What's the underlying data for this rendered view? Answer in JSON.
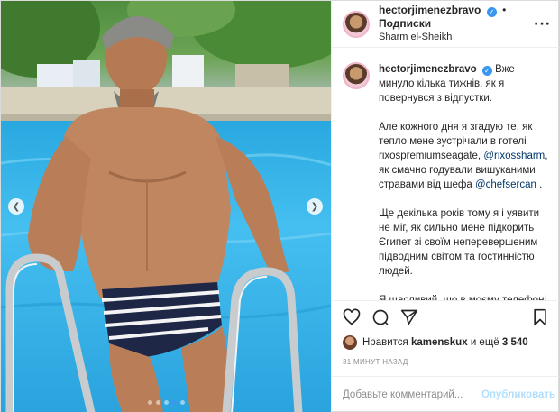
{
  "header": {
    "username": "hectorjimenezbravo",
    "separator": "•",
    "follow_label": "Подписки",
    "location": "Sharm el-Sheikh",
    "more_icon": "more-horizontal-icon"
  },
  "caption": {
    "username": "hectorjimenezbravo",
    "intro": "Вже минуло кілька тижнів, як я повернувся з відпустки.",
    "p2_a": "Але кожного дня я згадую те, як тепло мене зустрічали в готелі rixospremiumseagate,",
    "p2_mention1": "@rixossharm",
    "p2_b": ", як смачно годували вишуканими стравами від шефа",
    "p2_mention2": "@chefsercan",
    "p2_c": ".",
    "p3": "Ще декілька років тому я і уявити не міг, як сильно мене підкорить Єгипет зі своїм неперевершеним підводним світом та гостинністю людей.",
    "p4": "Я щасливий, що в моєму телефоні залишилася сотня знімків, які я можу передивлятися та поринати знову і"
  },
  "actions": {
    "like_icon": "heart-icon",
    "comment_icon": "comment-icon",
    "share_icon": "share-icon",
    "save_icon": "bookmark-icon"
  },
  "likes": {
    "prefix": "Нравится",
    "user": "kamenskux",
    "middle": "и ещё",
    "count": "3 540"
  },
  "timestamp": "31 МИНУТ НАЗАД",
  "comment": {
    "placeholder": "Добавьте комментарий...",
    "publish_label": "Опубликовать"
  },
  "carousel": {
    "prev_icon": "chevron-left-icon",
    "next_icon": "chevron-right-icon",
    "slide_count": 5,
    "active_slide": 4
  },
  "colors": {
    "accent": "#3897f0",
    "publish_disabled": "#b2dffc",
    "mention": "#00376b"
  }
}
